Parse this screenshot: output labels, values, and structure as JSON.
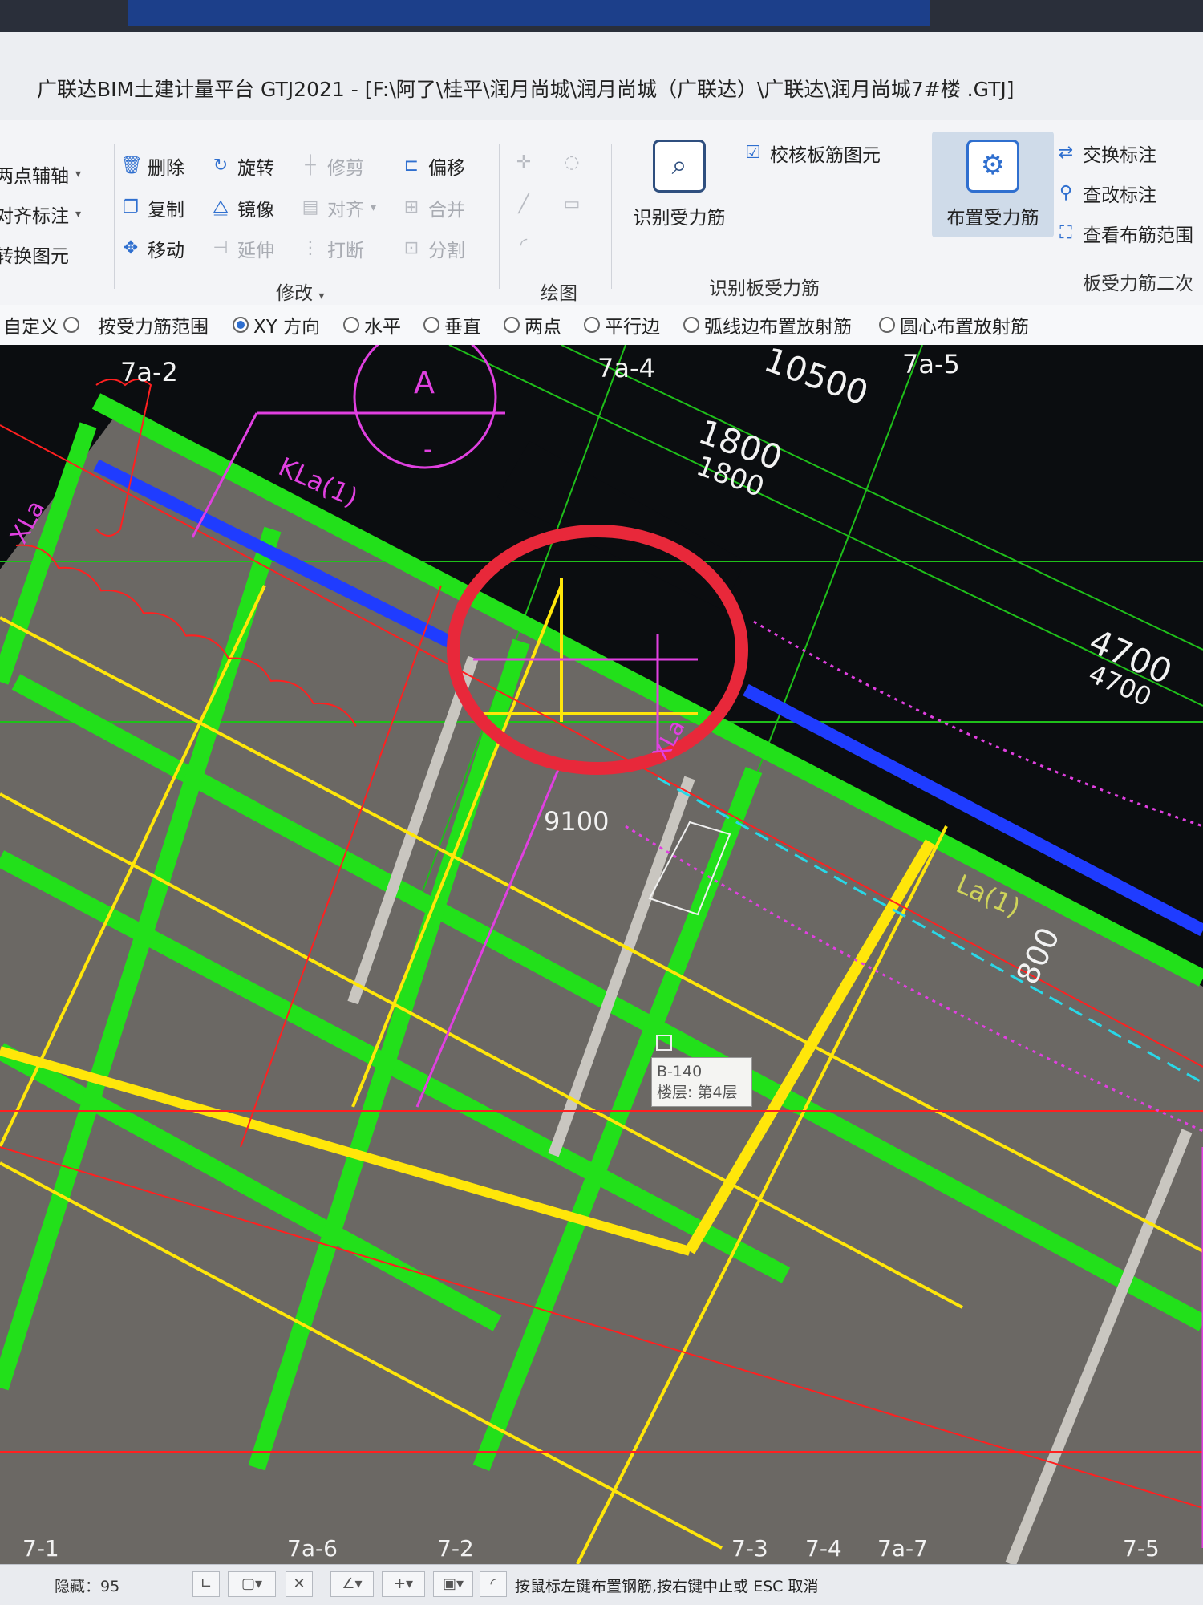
{
  "window": {
    "title": "广联达BIM土建计量平台 GTJ2021 - [F:\\阿了\\桂平\\润月尚城\\润月尚城（广联达）\\广联达\\润月尚城7#楼 .GTJ]"
  },
  "ribbon": {
    "left_items": [
      "两点辅轴",
      "对齐标注",
      "转换图元"
    ],
    "modify": {
      "delete": "删除",
      "copy": "复制",
      "move": "移动",
      "rotate": "旋转",
      "mirror": "镜像",
      "extend": "延伸",
      "trim": "修剪",
      "align": "对齐",
      "break": "打断",
      "offset": "偏移",
      "merge": "合并",
      "split": "分割",
      "group_label": "修改"
    },
    "draw": {
      "group_label": "绘图"
    },
    "identify": {
      "identify_button": "识别受力筋",
      "check_button": "校核板筋图元",
      "group_label": "识别板受力筋"
    },
    "layout_button": "布置受力筋",
    "right": {
      "swap": "交换标注",
      "edit": "查改标注",
      "view_range": "查看布筋范围",
      "group_label": "板受力筋二次"
    }
  },
  "options": {
    "items": [
      "自定义",
      "按受力筋范围",
      "XY 方向",
      "水平",
      "垂直",
      "两点",
      "平行边",
      "弧线边布置放射筋",
      "圆心布置放射筋"
    ],
    "selected": "XY 方向"
  },
  "canvas": {
    "axis_labels_top": [
      "7a-2",
      "7a-4",
      "7a-5"
    ],
    "axis_labels_bottom": [
      "7-1",
      "7a-6",
      "7-2",
      "7-3",
      "7-4",
      "7a-7",
      "7-5"
    ],
    "grid_bubble": "A",
    "grid_bubble_sub": "-",
    "dims": [
      "10500",
      "1800",
      "1800",
      "4700",
      "4700",
      "9100",
      "800"
    ],
    "beam_labels": [
      "XLa",
      "KLa(1)",
      "XLa",
      "La(1)"
    ],
    "tooltip": {
      "id": "B-140",
      "floor": "楼层: 第4层"
    }
  },
  "status": {
    "hidden": "隐藏：95",
    "hint": "按鼠标左键布置钢筋,按右键中止或 ESC 取消"
  },
  "colors": {
    "slab": "#6f6c68",
    "beam_green": "#22e01a",
    "yellow": "#ffe60a",
    "magenta": "#e040e0",
    "red": "#ff2020",
    "blue": "#1f3cff",
    "highlight_circle": "#e8283a"
  }
}
